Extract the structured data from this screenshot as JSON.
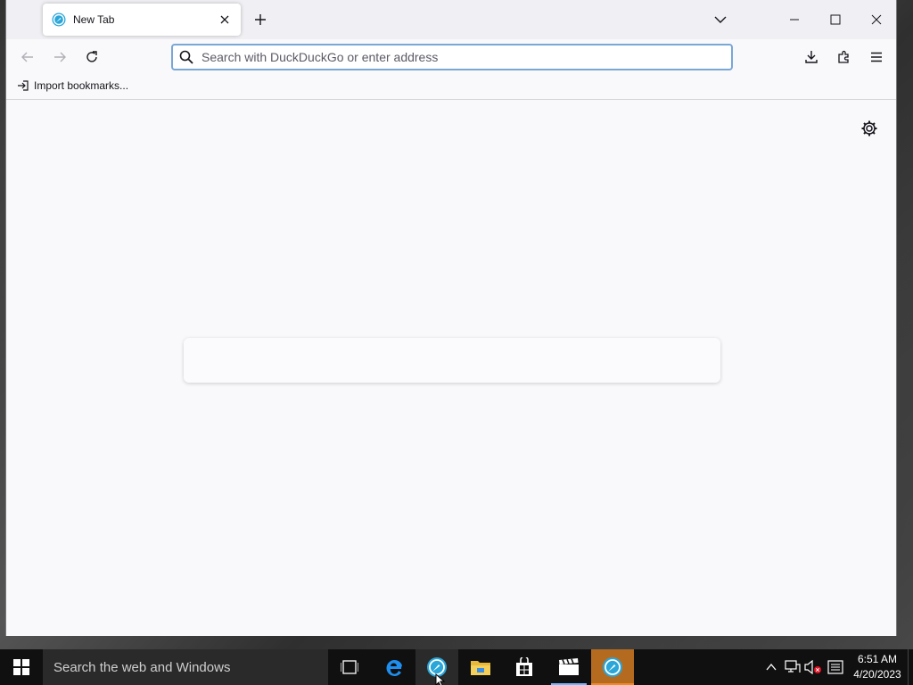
{
  "browser": {
    "tab": {
      "title": "New Tab"
    },
    "urlbar": {
      "placeholder": "Search with DuckDuckGo or enter address"
    },
    "bookmarks": {
      "import_label": "Import bookmarks..."
    }
  },
  "taskbar": {
    "search_placeholder": "Search the web and Windows",
    "clock": {
      "time": "6:51 AM",
      "date": "4/20/2023"
    }
  },
  "colors": {
    "accent_focus": "#7aa7d6",
    "browser_bg": "#f9f9fb",
    "taskbar_bg": "#101010",
    "taskbar_active": "#b56b1f"
  }
}
